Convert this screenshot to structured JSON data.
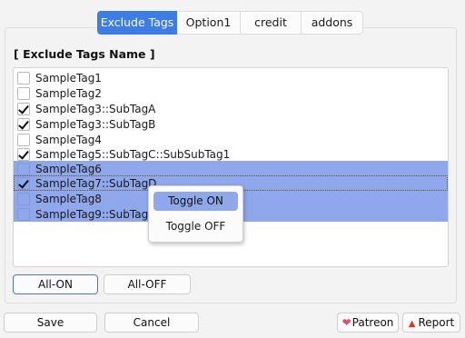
{
  "tabs": [
    {
      "label": "Exclude Tags",
      "active": true
    },
    {
      "label": "Option1",
      "active": false
    },
    {
      "label": "credit",
      "active": false
    },
    {
      "label": "addons",
      "active": false
    }
  ],
  "section_title": "[ Exclude Tags Name ]",
  "tags": [
    {
      "label": "SampleTag1",
      "checked": false,
      "selected": false
    },
    {
      "label": "SampleTag2",
      "checked": false,
      "selected": false
    },
    {
      "label": "SampleTag3::SubTagA",
      "checked": true,
      "selected": false
    },
    {
      "label": "SampleTag3::SubTagB",
      "checked": true,
      "selected": false
    },
    {
      "label": "SampleTag4",
      "checked": false,
      "selected": false
    },
    {
      "label": "SampleTag5::SubTagC::SubSubTag1",
      "checked": true,
      "selected": false
    },
    {
      "label": "SampleTag6",
      "checked": false,
      "selected": true
    },
    {
      "label": "SampleTag7::SubTagD",
      "checked": true,
      "selected": true,
      "focused": true
    },
    {
      "label": "SampleTag8",
      "checked": false,
      "selected": true
    },
    {
      "label": "SampleTag9::SubTagE",
      "checked": false,
      "selected": true
    }
  ],
  "buttons": {
    "all_on": "All-ON",
    "all_off": "All-OFF",
    "save": "Save",
    "cancel": "Cancel",
    "patreon": "Patreon",
    "report": "Report"
  },
  "context_menu": {
    "items": [
      {
        "label": "Toggle ON",
        "hover": true
      },
      {
        "label": "Toggle OFF",
        "hover": false
      }
    ]
  },
  "icons": {
    "patreon": "heart-icon",
    "report": "siren-icon"
  },
  "colors": {
    "accent": "#3c7ee6",
    "selection": "#8fa7eb"
  }
}
